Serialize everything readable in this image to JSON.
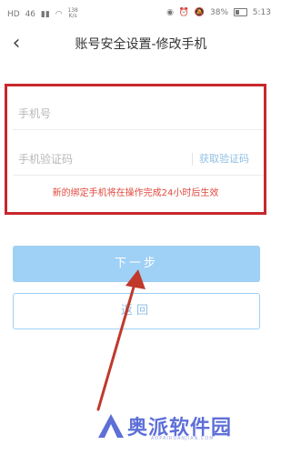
{
  "status_bar": {
    "network": "HD",
    "signal": "46",
    "speed_value": "138",
    "speed_unit": "K/s",
    "battery": "38%",
    "time": "5:13"
  },
  "header": {
    "back_label": "‹",
    "title": "账号安全设置-修改手机"
  },
  "form": {
    "phone_placeholder": "手机号",
    "code_placeholder": "手机验证码",
    "get_code_label": "获取验证码",
    "notice": "新的绑定手机将在操作完成24小时后生效"
  },
  "buttons": {
    "next_label": "下一步",
    "back_label": "返回"
  },
  "watermark": {
    "brand": "奥派软件园",
    "sub": "AOPAIRUANJIAN.COM"
  },
  "colors": {
    "primary": "#9fd0f5",
    "highlight_box": "#c8272d",
    "notice_text": "#e2483e",
    "annotation_arrow": "#c0392b",
    "watermark": "#5e6fd8"
  },
  "icons": [
    "alarm-icon",
    "mute-icon",
    "wifi-icon",
    "battery-icon",
    "eye-icon",
    "back-arrow-icon"
  ]
}
